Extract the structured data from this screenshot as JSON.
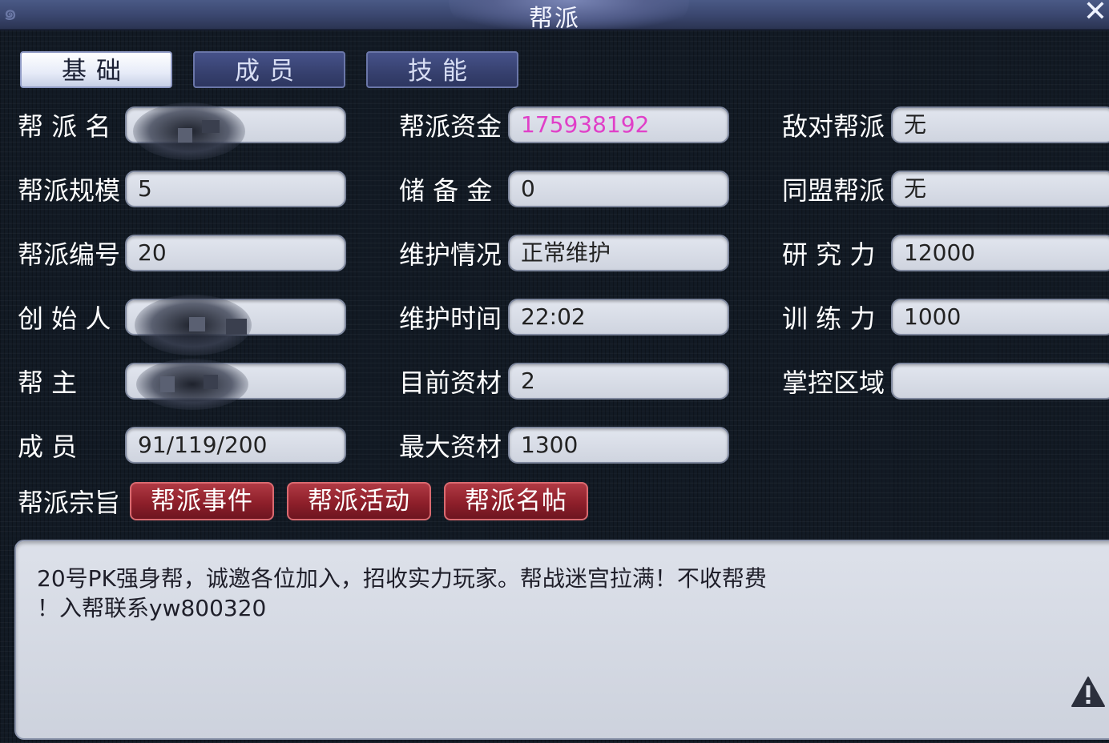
{
  "window": {
    "title": "帮派",
    "close_symbol": "✕"
  },
  "tabs": [
    {
      "label": "基础",
      "active": true
    },
    {
      "label": "成员",
      "active": false
    },
    {
      "label": "技能",
      "active": false
    }
  ],
  "fields": {
    "guild_name": {
      "label": "帮 派 名",
      "value": ""
    },
    "guild_scale": {
      "label": "帮派规模",
      "value": "5"
    },
    "guild_id": {
      "label": "帮派编号",
      "value": "20"
    },
    "founder": {
      "label": "创 始 人",
      "value": ""
    },
    "leader": {
      "label": "帮    主",
      "value": ""
    },
    "members": {
      "label": "成    员",
      "value": "91/119/200"
    },
    "funds": {
      "label": "帮派资金",
      "value": "175938192",
      "color": "#e040c8"
    },
    "reserve": {
      "label": "储 备 金",
      "value": "0"
    },
    "maintenance_status": {
      "label": "维护情况",
      "value": "正常维护"
    },
    "maintenance_time": {
      "label": "维护时间",
      "value": "22:02"
    },
    "current_materials": {
      "label": "目前资材",
      "value": "2"
    },
    "max_materials": {
      "label": "最大资材",
      "value": "1300"
    },
    "hostile_guild": {
      "label": "敌对帮派",
      "value": "无"
    },
    "allied_guild": {
      "label": "同盟帮派",
      "value": "无"
    },
    "research": {
      "label": "研 究 力",
      "value": "12000"
    },
    "training": {
      "label": "训 练 力",
      "value": "1000"
    },
    "controlled_area": {
      "label": "掌控区域",
      "value": ""
    }
  },
  "motto": {
    "label": "帮派宗旨",
    "text_line1": "20号PK强身帮，诚邀各位加入，招收实力玩家。帮战迷宫拉满！不收帮费",
    "text_line2": "！入帮联系yw800320"
  },
  "buttons": {
    "events": "帮派事件",
    "activities": "帮派活动",
    "card": "帮派名帖"
  },
  "colors": {
    "accent_red": "#8e1f2a",
    "funds_magenta": "#e040c8",
    "tab_active": "#ffffff",
    "tab_inactive": "#3a4576"
  }
}
